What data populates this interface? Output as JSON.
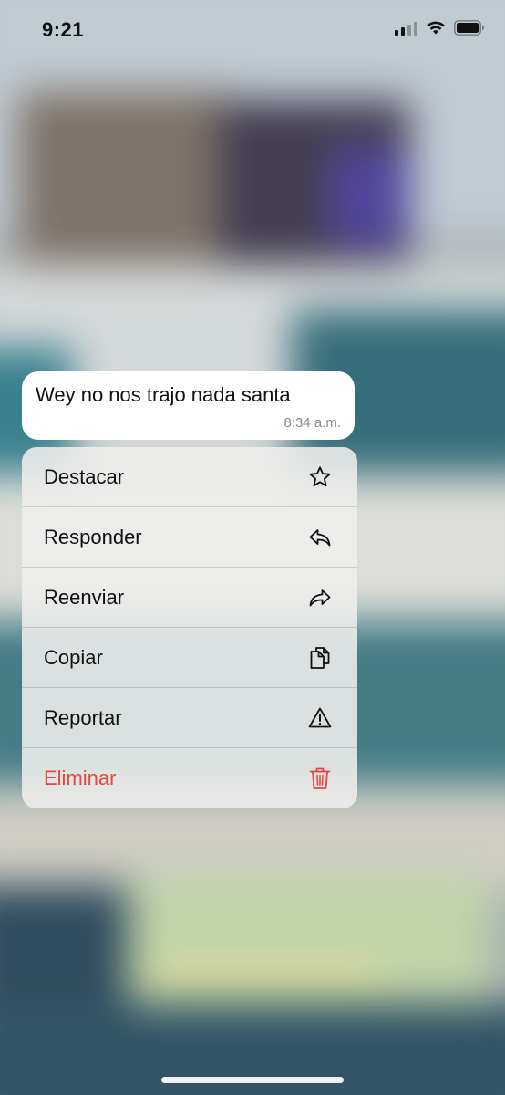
{
  "status_bar": {
    "time": "9:21",
    "signal_bars": 4,
    "signal_bars_active": 2,
    "icons": [
      "signal-icon",
      "wifi-icon",
      "battery-icon"
    ]
  },
  "message": {
    "text": "Wey no nos trajo nada santa",
    "time": "8:34 a.m."
  },
  "menu": {
    "items": [
      {
        "label": "Destacar",
        "icon": "star-icon"
      },
      {
        "label": "Responder",
        "icon": "reply-icon"
      },
      {
        "label": "Reenviar",
        "icon": "forward-icon"
      },
      {
        "label": "Copiar",
        "icon": "copy-icon"
      },
      {
        "label": "Reportar",
        "icon": "warning-icon"
      },
      {
        "label": "Eliminar",
        "icon": "trash-icon",
        "destructive": true
      }
    ]
  },
  "colors": {
    "destructive": "#e5483e",
    "menu_text": "#111111",
    "bubble": "#ffffff"
  }
}
